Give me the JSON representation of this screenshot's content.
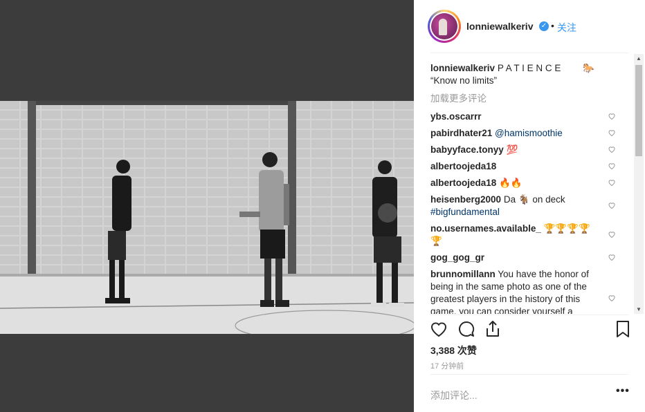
{
  "post": {
    "username": "lonniewalkeriv",
    "verified_mark": "✓",
    "separator": "•",
    "follow_label": "关注"
  },
  "caption": {
    "username": "lonniewalkeriv",
    "text": "P A T I E N C E",
    "emoji": "🐎",
    "line2": "“Know no limits”"
  },
  "load_more": "加载更多评论",
  "comments": [
    {
      "user": "ybs.oscarrr",
      "text": ""
    },
    {
      "user": "pabirdhater21",
      "text": "@hamismoothie"
    },
    {
      "user": "babyyface.tonyy",
      "text": "💯"
    },
    {
      "user": "albertoojeda18",
      "text": ""
    },
    {
      "user": "albertoojeda18",
      "text": "🔥🔥"
    },
    {
      "user": "heisenberg2000",
      "text": "Da 🐐 on deck",
      "text2": "#bigfundamental"
    },
    {
      "user": "no.usernames.available_",
      "text": "🏆🏆🏆🏆",
      "text2": "🏆"
    },
    {
      "user": "gog_gog_gr",
      "text": ""
    },
    {
      "user": "brunnomillann",
      "text": "You have the honor of being in the same photo as one of the greatest players in the history of this game, you can consider yourself a"
    }
  ],
  "likes": "3,388 次赞",
  "time_ago": "17 分钟前",
  "add_comment_placeholder": "添加评论...",
  "more_label": "•••",
  "scroll": {
    "up": "▲",
    "down": "▼"
  },
  "icons": {
    "like": "heart-icon",
    "comment": "comment-icon",
    "share": "share-icon",
    "save": "bookmark-icon"
  },
  "colors": {
    "accent": "#3897f0",
    "text": "#262626",
    "muted": "#999999",
    "photo_bg": "#3c3c3c"
  }
}
